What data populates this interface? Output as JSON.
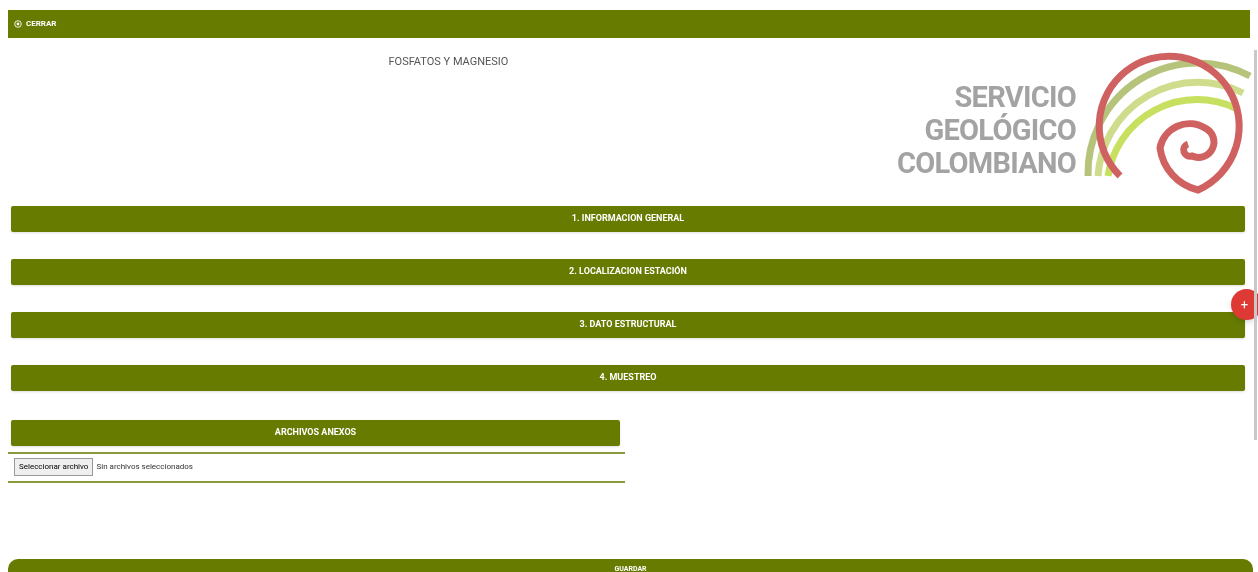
{
  "top_bar": {
    "close_label": "CERRAR"
  },
  "form_title": "FOSFATOS Y MAGNESIO",
  "logo": {
    "lines": [
      "SERVICIO",
      "GEOLÓGICO",
      "COLOMBIANO"
    ]
  },
  "sections": [
    {
      "label": "1. INFORMACION GENERAL"
    },
    {
      "label": "2. LOCALIZACION ESTACIÓN"
    },
    {
      "label": "3. DATO ESTRUCTURAL"
    },
    {
      "label": "4. MUESTREO"
    }
  ],
  "attachments": {
    "title": "ARCHIVOS ANEXOS",
    "button": "Seleccionar archivo",
    "status": "Sin archivos seleccionados"
  },
  "fab": "+",
  "save_button": "GUARDAR"
}
